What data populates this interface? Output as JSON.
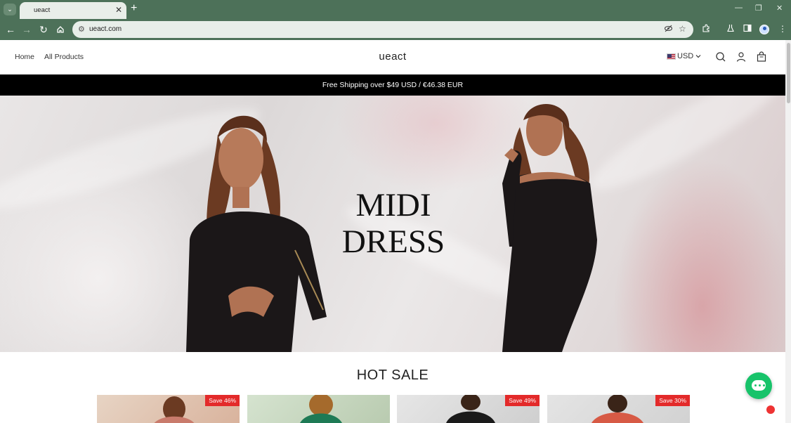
{
  "browser": {
    "tab_title": "ueact",
    "url": "ueact.com",
    "new_tab_symbol": "+",
    "close_symbol": "✕"
  },
  "header": {
    "nav": [
      "Home",
      "All Products"
    ],
    "logo": "ueact",
    "currency": "USD"
  },
  "announcement": "Free Shipping over $49 USD / €46.38 EUR",
  "hero": {
    "title_line1": "MIDI",
    "title_line2": "DRESS"
  },
  "hot_sale": {
    "title": "HOT SALE",
    "products": [
      {
        "badge": "Save 46%",
        "image_colors": [
          "#e7d4c4",
          "#c97b6c"
        ]
      },
      {
        "badge": "",
        "image_colors": [
          "#cfe0c8",
          "#1e7a55"
        ]
      },
      {
        "badge": "Save 49%",
        "image_colors": [
          "#dcdcdc",
          "#1a1a1a"
        ]
      },
      {
        "badge": "Save 30%",
        "image_colors": [
          "#dedede",
          "#d75a45"
        ]
      }
    ]
  },
  "colors": {
    "chrome": "#4d7159",
    "announcement_bg": "#000000",
    "sale_badge": "#e32a2a",
    "chat": "#17c36a"
  }
}
